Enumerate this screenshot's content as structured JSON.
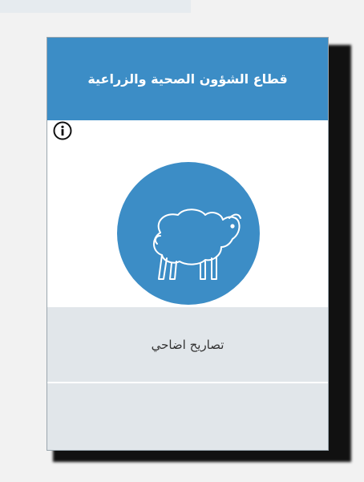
{
  "card": {
    "title": "قطاع الشؤون الصحية والزراعية",
    "service_label": "تصاريح اضاحي",
    "icon": "sheep-icon",
    "info_icon": "info-icon"
  },
  "colors": {
    "brand_blue": "#3c8dc6",
    "band_gray": "#e1e6ea",
    "page_bg": "#f2f2f2"
  }
}
